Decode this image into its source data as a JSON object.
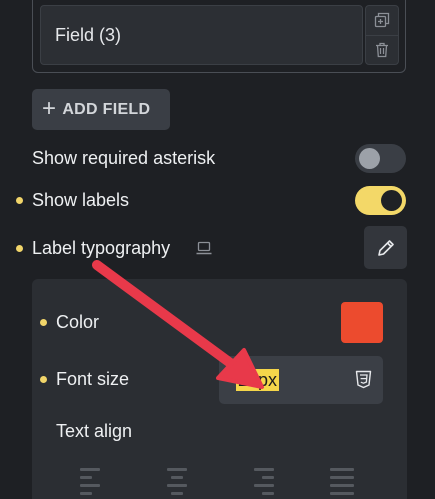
{
  "repeater": {
    "field_label": "Field (3)",
    "duplicate_icon": "duplicate-icon",
    "delete_icon": "trash-icon"
  },
  "add_field": {
    "label": "ADD FIELD",
    "icon": "plus-icon"
  },
  "settings": {
    "required_asterisk": {
      "label": "Show required asterisk",
      "enabled": false
    },
    "show_labels": {
      "label": "Show labels",
      "enabled": true
    },
    "label_typography": {
      "label": "Label typography",
      "device_icon": "laptop-icon",
      "edit_icon": "pencil-icon"
    }
  },
  "typography_panel": {
    "color": {
      "label": "Color",
      "value": "#ec4b2e"
    },
    "font_size": {
      "label": "Font size",
      "value": "20px",
      "units_icon": "css3-icon"
    },
    "text_align": {
      "label": "Text align",
      "options": [
        "left",
        "center",
        "right",
        "justify"
      ]
    }
  },
  "colors": {
    "background": "#1e2024",
    "panel": "#2b2e33",
    "accent_yellow": "#f3d868",
    "annotation_arrow": "#e8394a"
  }
}
